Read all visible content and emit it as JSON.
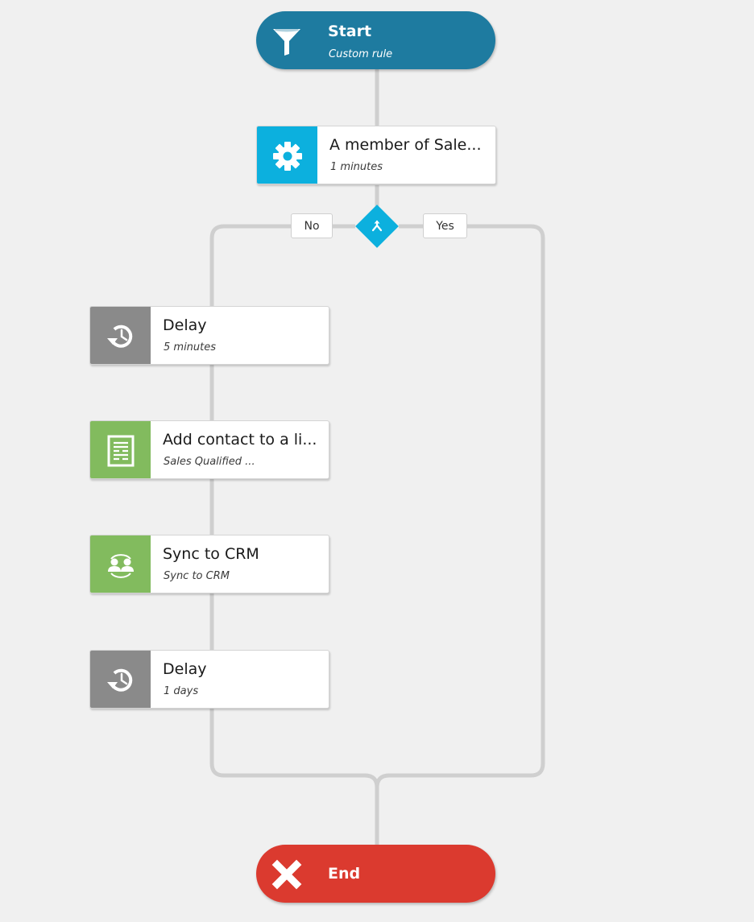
{
  "workflow": {
    "start": {
      "title": "Start",
      "subtitle": "Custom rule",
      "icon": "funnel-icon",
      "color": "#1e7ba0"
    },
    "condition": {
      "title": "A member of Sale...",
      "subtitle": "1 minutes",
      "icon": "gear-icon",
      "color": "#0cb0de"
    },
    "decision": {
      "icon": "split-branch-icon",
      "color": "#0cb0de",
      "no_label": "No",
      "yes_label": "Yes"
    },
    "no_branch": [
      {
        "title": "Delay",
        "subtitle": "5 minutes",
        "icon": "delay-clock-icon",
        "color": "#8a8a8a"
      },
      {
        "title": "Add contact to a li...",
        "subtitle": "Sales Qualified ...",
        "icon": "list-document-icon",
        "color": "#82bb5e"
      },
      {
        "title": "Sync to CRM",
        "subtitle": "Sync to CRM",
        "icon": "sync-contacts-icon",
        "color": "#82bb5e"
      },
      {
        "title": "Delay",
        "subtitle": "1 days",
        "icon": "delay-clock-icon",
        "color": "#8a8a8a"
      }
    ],
    "yes_branch": [],
    "end": {
      "title": "End",
      "icon": "close-x-icon",
      "color": "#db3a2f"
    },
    "connector_color": "#cfcfcf"
  }
}
